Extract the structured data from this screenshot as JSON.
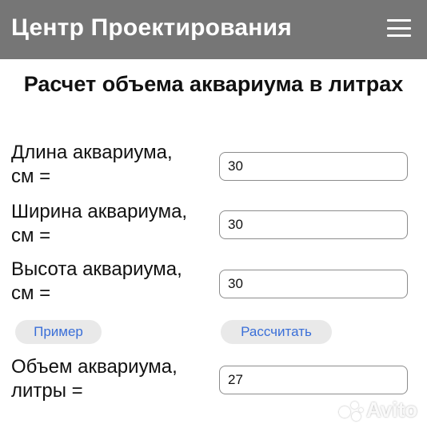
{
  "header": {
    "brand": "Центр Проектирования",
    "menu_icon": "hamburger-menu-icon"
  },
  "page": {
    "title": "Расчет объема аквариума в литрах"
  },
  "form": {
    "length": {
      "label_line1": "Длина аквариума,",
      "label_line2": "см =",
      "value": "30"
    },
    "width": {
      "label_line1": "Ширина аквариума,",
      "label_line2": "см =",
      "value": "30"
    },
    "height": {
      "label_line1": "Высота аквариума,",
      "label_line2": "см =",
      "value": "30"
    },
    "example_button": "Пример",
    "calculate_button": "Рассчитать",
    "volume": {
      "label_line1": "Объем аквариума,",
      "label_line2": "литры =",
      "value": "27"
    }
  },
  "colors": {
    "header_bg": "#767676",
    "button_text": "#3a6fd8",
    "button_bg": "#e9e9e9"
  },
  "watermark": {
    "icon": "avito-dots-icon",
    "text": "Avito"
  }
}
